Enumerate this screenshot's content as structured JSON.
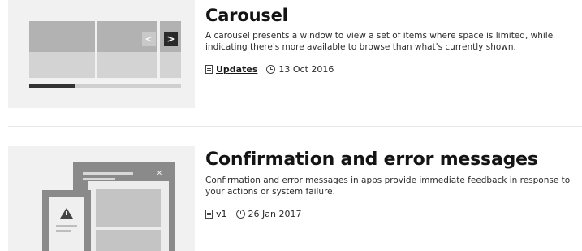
{
  "items": [
    {
      "title": "Carousel",
      "description": "A carousel presents a window to view a set of items where space is limited, while indicating there's more available to browse than what's currently shown.",
      "tag": "Updates",
      "date": "13 Oct 2016",
      "illustration": {
        "prev_glyph": "<",
        "next_glyph": ">",
        "progress_fraction": 0.3
      }
    },
    {
      "title": "Confirmation and error messages",
      "description": "Confirmation and error messages in apps provide immediate feedback in response to your actions or system failure.",
      "tag": "v1",
      "date": "26 Jan 2017",
      "illustration": {
        "close_glyph": "×"
      }
    }
  ],
  "icons": {
    "tag_icon": "document-icon",
    "date_icon": "clock-icon",
    "warning_icon": "warning-icon"
  },
  "colors": {
    "thumbnail_bg": "#f1f1f1",
    "text": "#1a1a1a",
    "divider": "#e6e6e6"
  }
}
